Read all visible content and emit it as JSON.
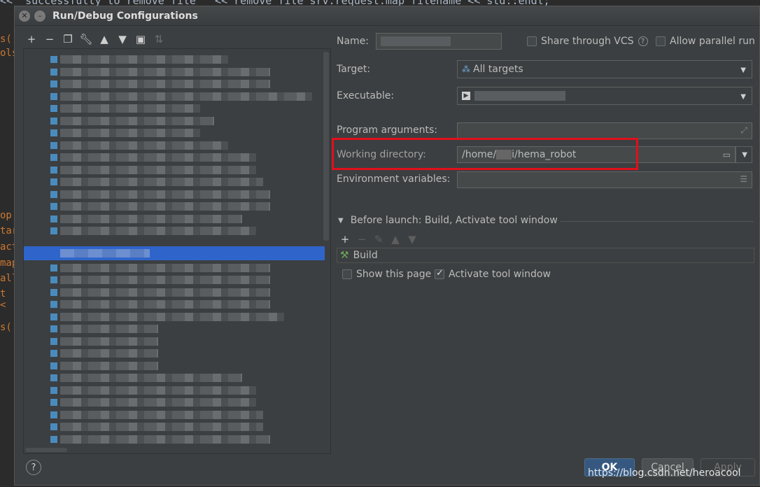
{
  "background_editor": {
    "code_line": "<< \"successfully to remove file \" << remove_file_srv.request.map_filename << std::endl;",
    "gutter_fragments": [
      "s('",
      "ols",
      "op",
      "tar",
      "act",
      "map",
      "all",
      "t <",
      "s('"
    ]
  },
  "dialog": {
    "title": "Run/Debug Configurations"
  },
  "left_toolbar": {
    "icons": [
      "plus-icon",
      "minus-icon",
      "copy-icon",
      "wrench-icon",
      "arrow-up-icon",
      "arrow-down-icon",
      "folder-icon",
      "sort-icon"
    ]
  },
  "form": {
    "name_label": "Name:",
    "share_vcs_label": "Share through VCS",
    "allow_parallel_label": "Allow parallel run",
    "target_label": "Target:",
    "target_value": "All targets",
    "executable_label": "Executable:",
    "program_args_label": "Program arguments:",
    "working_dir_label": "Working directory:",
    "working_dir_value_start": "/home/",
    "working_dir_value_end": "i/hema_robot",
    "env_vars_label": "Environment variables:"
  },
  "before_launch": {
    "title": "Before launch: Build, Activate tool window",
    "item": "Build",
    "show_page_label": "Show this page",
    "show_page_checked": false,
    "activate_label": "Activate tool window",
    "activate_checked": true
  },
  "buttons": {
    "help": "?",
    "ok": "OK",
    "cancel": "Cancel",
    "apply": "Apply"
  },
  "watermark": "https://blog.csdn.net/heroacool",
  "colors": {
    "selection": "#2f65ca",
    "highlight_box": "#e0101b",
    "dialog_bg": "#3c3f41"
  }
}
